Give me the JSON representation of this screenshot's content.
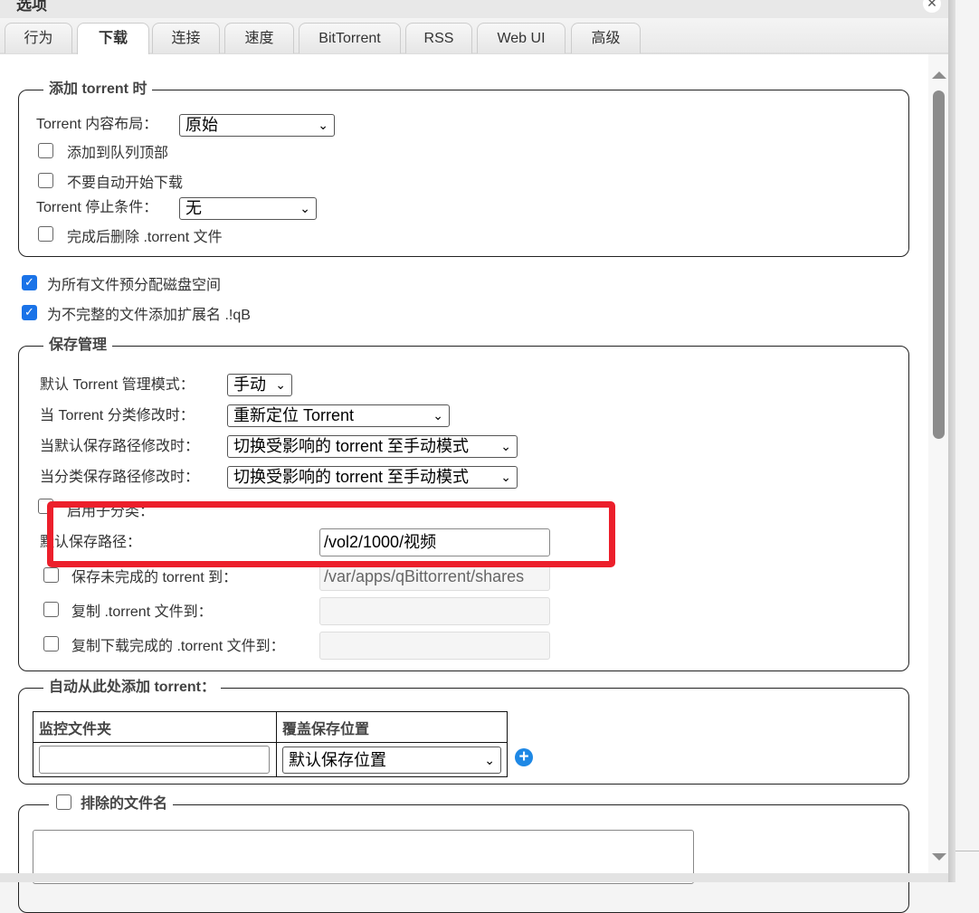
{
  "dialog": {
    "title": "选项"
  },
  "tabs": [
    "行为",
    "下载",
    "连接",
    "速度",
    "BitTorrent",
    "RSS",
    "Web UI",
    "高级"
  ],
  "active_tab": "下载",
  "add_torrent": {
    "legend": "添加 torrent 时",
    "layout_label": "Torrent 内容布局：",
    "layout_value": "原始",
    "add_to_top": "添加到队列顶部",
    "dont_start": "不要自动开始下载",
    "stop_condition_label": "Torrent 停止条件：",
    "stop_condition_value": "无",
    "delete_torrent": "完成后删除 .torrent 文件"
  },
  "preallocate": "为所有文件预分配磁盘空间",
  "append_ext": "为不完整的文件添加扩展名 .!qB",
  "save_mgmt": {
    "legend": "保存管理",
    "mode_label": "默认 Torrent 管理模式：",
    "mode_value": "手动",
    "cat_changed_label": "当 Torrent 分类修改时：",
    "cat_changed_value": "重新定位 Torrent",
    "default_path_changed_label": "当默认保存路径修改时：",
    "default_path_changed_value": "切换受影响的 torrent 至手动模式",
    "cat_path_changed_label": "当分类保存路径修改时：",
    "cat_path_changed_value": "切换受影响的 torrent 至手动模式",
    "subcategories": "启用子分类：",
    "default_save_path_label": "默认保存路径：",
    "default_save_path_value": "/vol2/1000/视频",
    "incomplete_label": "保存未完成的 torrent 到：",
    "incomplete_value": "/var/apps/qBittorrent/shares",
    "copy_torrent_label": "复制 .torrent 文件到：",
    "copy_finished_label": "复制下载完成的 .torrent 文件到："
  },
  "watch": {
    "legend": "自动从此处添加 torrent：",
    "col_folder": "监控文件夹",
    "col_location": "覆盖保存位置",
    "location_value": "默认保存位置"
  },
  "excluded": {
    "legend": "排除的文件名"
  }
}
